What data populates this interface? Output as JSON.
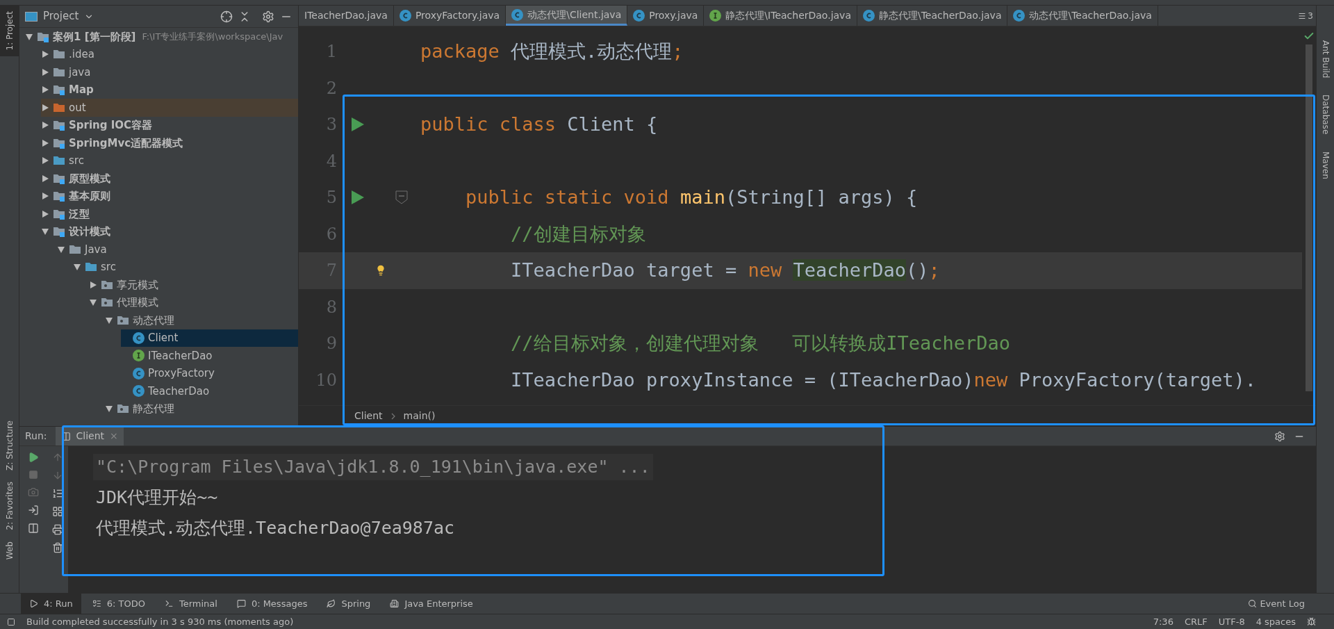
{
  "left_stripe": [
    {
      "label": "1: Project",
      "selected": true
    },
    {
      "label": "Z: Structure",
      "selected": false
    },
    {
      "label": "2: Favorites",
      "selected": false
    },
    {
      "label": "Web",
      "selected": false
    }
  ],
  "project": {
    "title": "Project",
    "tree": [
      {
        "label": "案例1 [第一阶段]",
        "path": "F:\\IT专业练手案例\\workspace\\Jav",
        "kind": "module",
        "bold": true,
        "expanded": true,
        "selected": false,
        "children": [
          {
            "label": ".idea",
            "kind": "folder",
            "bold": false,
            "expanded": false,
            "selected": false
          },
          {
            "label": "java",
            "kind": "folder",
            "bold": false,
            "expanded": false,
            "selected": false
          },
          {
            "label": "Map",
            "kind": "module",
            "bold": true,
            "expanded": false,
            "selected": false
          },
          {
            "label": "out",
            "kind": "excluded",
            "bold": false,
            "expanded": false,
            "selected": false
          },
          {
            "label": "Spring IOC容器",
            "kind": "module",
            "bold": true,
            "expanded": false,
            "selected": false
          },
          {
            "label": "SpringMvc适配器模式",
            "kind": "module",
            "bold": true,
            "expanded": false,
            "selected": false
          },
          {
            "label": "src",
            "kind": "source",
            "bold": false,
            "expanded": false,
            "selected": false
          },
          {
            "label": "原型模式",
            "kind": "module",
            "bold": true,
            "expanded": false,
            "selected": false
          },
          {
            "label": "基本原则",
            "kind": "module",
            "bold": true,
            "expanded": false,
            "selected": false
          },
          {
            "label": "泛型",
            "kind": "module",
            "bold": true,
            "expanded": false,
            "selected": false
          },
          {
            "label": "设计模式",
            "kind": "module",
            "bold": true,
            "expanded": true,
            "selected": false,
            "children": [
              {
                "label": "Java",
                "kind": "folder",
                "bold": false,
                "expanded": true,
                "selected": false,
                "children": [
                  {
                    "label": "src",
                    "kind": "source",
                    "bold": false,
                    "expanded": true,
                    "selected": false,
                    "children": [
                      {
                        "label": "享元模式",
                        "kind": "package",
                        "bold": false,
                        "expanded": false,
                        "selected": false
                      },
                      {
                        "label": "代理模式",
                        "kind": "package",
                        "bold": false,
                        "expanded": true,
                        "selected": false,
                        "children": [
                          {
                            "label": "动态代理",
                            "kind": "package",
                            "bold": false,
                            "expanded": true,
                            "selected": false,
                            "children": [
                              {
                                "label": "Client",
                                "kind": "class",
                                "bold": false,
                                "selected": true
                              },
                              {
                                "label": "ITeacherDao",
                                "kind": "interface",
                                "bold": false,
                                "selected": false
                              },
                              {
                                "label": "ProxyFactory",
                                "kind": "class",
                                "bold": false,
                                "selected": false
                              },
                              {
                                "label": "TeacherDao",
                                "kind": "class",
                                "bold": false,
                                "selected": false
                              }
                            ]
                          },
                          {
                            "label": "静态代理",
                            "kind": "package",
                            "bold": false,
                            "expanded": true,
                            "selected": false
                          }
                        ]
                      }
                    ]
                  }
                ]
              }
            ]
          }
        ]
      }
    ]
  },
  "tabs": [
    {
      "label": "ITeacherDao.java",
      "kind": "none",
      "selected": false
    },
    {
      "label": "ProxyFactory.java",
      "kind": "class",
      "selected": false
    },
    {
      "label": "动态代理\\Client.java",
      "kind": "class",
      "selected": true
    },
    {
      "label": "Proxy.java",
      "kind": "class",
      "selected": false
    },
    {
      "label": "静态代理\\ITeacherDao.java",
      "kind": "interface",
      "selected": false
    },
    {
      "label": "静态代理\\TeacherDao.java",
      "kind": "class",
      "selected": false
    },
    {
      "label": "动态代理\\TeacherDao.java",
      "kind": "class",
      "selected": false
    }
  ],
  "tabs_overflow": "3",
  "code": [
    {
      "number": "1",
      "run": false,
      "fold": false,
      "bulb": false,
      "caret_line": false,
      "tokens": [
        {
          "t": "package",
          "kind": "keyword"
        },
        {
          "t": " 代理模式.动态代理",
          "kind": "plain"
        },
        {
          "t": ";",
          "kind": "keyword"
        }
      ]
    },
    {
      "number": "2",
      "run": false,
      "fold": false,
      "bulb": false,
      "caret_line": false
    },
    {
      "number": "3",
      "run": true,
      "fold": false,
      "bulb": false,
      "caret_line": false,
      "tokens": [
        {
          "t": "public class",
          "kind": "keyword"
        },
        {
          "t": " Client {",
          "kind": "plain"
        }
      ]
    },
    {
      "number": "4",
      "run": false,
      "fold": false,
      "bulb": false,
      "caret_line": false
    },
    {
      "number": "5",
      "run": true,
      "fold": true,
      "bulb": false,
      "caret_line": false,
      "tokens": [
        {
          "t": "    public static void",
          "kind": "keyword"
        },
        {
          "t": " main",
          "kind": "function"
        },
        {
          "t": "(String[] args) {",
          "kind": "plain"
        }
      ]
    },
    {
      "number": "6",
      "run": false,
      "fold": false,
      "bulb": false,
      "caret_line": false,
      "tokens": [
        {
          "t": "        //创建目标对象",
          "kind": "comment"
        }
      ]
    },
    {
      "number": "7",
      "run": false,
      "fold": false,
      "bulb": true,
      "caret_line": true,
      "tokens": [
        {
          "t": "        ITeacherDao target = ",
          "kind": "plain"
        },
        {
          "t": "new ",
          "kind": "keyword"
        },
        {
          "t": "TeacherDao",
          "kind": "highlight"
        },
        {
          "t": "()",
          "kind": "plain"
        },
        {
          "t": ";",
          "kind": "keyword"
        }
      ]
    },
    {
      "number": "8",
      "run": false,
      "fold": false,
      "bulb": false,
      "caret_line": false
    },
    {
      "number": "9",
      "run": false,
      "fold": false,
      "bulb": false,
      "caret_line": false,
      "tokens": [
        {
          "t": "        //给目标对象，创建代理对象   可以转换成ITeacherDao",
          "kind": "comment"
        }
      ]
    },
    {
      "number": "10",
      "run": false,
      "fold": false,
      "bulb": false,
      "caret_line": false,
      "tokens": [
        {
          "t": "        ITeacherDao proxyInstance = (ITeacherDao)",
          "kind": "plain"
        },
        {
          "t": "new",
          "kind": "keyword"
        },
        {
          "t": " ProxyFactory(target).",
          "kind": "plain"
        }
      ]
    }
  ],
  "breadcrumb": [
    "Client",
    "main()"
  ],
  "right_stripe": [
    "Ant Build",
    "Database",
    "Maven"
  ],
  "run": {
    "label": "Run:",
    "tab": "Client",
    "tab_close": "×",
    "output": [
      {
        "text": "\"C:\\Program Files\\Java\\jdk1.8.0_191\\bin\\java.exe\" ...",
        "kind": "command"
      },
      {
        "text": "JDK代理开始~~",
        "kind": "stdout"
      },
      {
        "text": "代理模式.动态代理.TeacherDao@7ea987ac",
        "kind": "stdout"
      }
    ]
  },
  "tool_windows": [
    {
      "label": "4: Run",
      "kind": "run",
      "selected": true
    },
    {
      "label": "6: TODO",
      "kind": "todo",
      "selected": false
    },
    {
      "label": "Terminal",
      "kind": "terminal",
      "selected": false
    },
    {
      "label": "0: Messages",
      "kind": "messages",
      "selected": false
    },
    {
      "label": "Spring",
      "kind": "spring",
      "selected": false
    },
    {
      "label": "Java Enterprise",
      "kind": "enterprise",
      "selected": false
    }
  ],
  "event_log": "Event Log",
  "status_bar": {
    "message": "Build completed successfully in 3 s 930 ms (moments ago)",
    "position": "7:36",
    "line_separator": "CRLF",
    "encoding": "UTF-8",
    "indent": "4 spaces"
  }
}
